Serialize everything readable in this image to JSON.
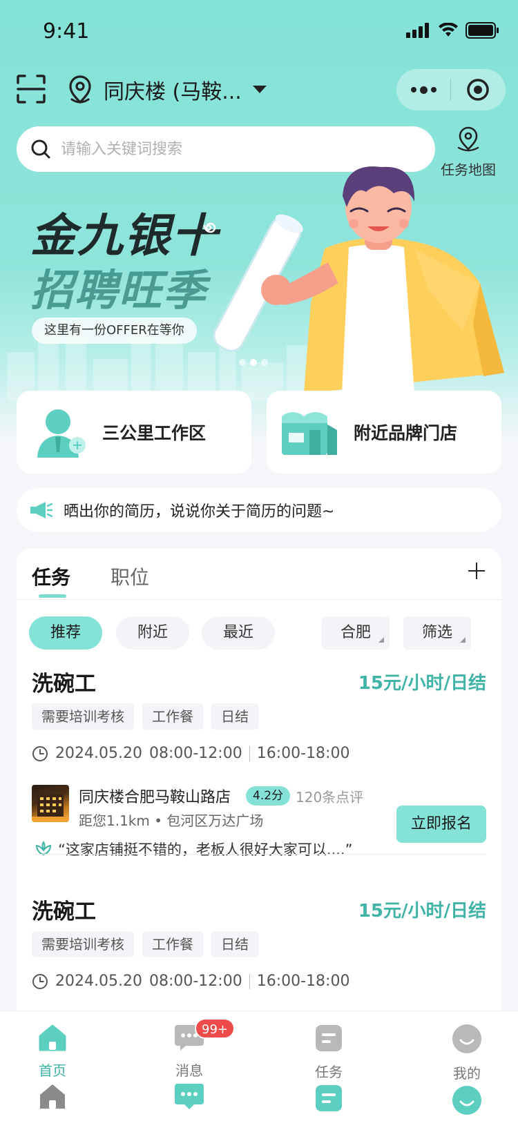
{
  "status_bar": {
    "time": "9:41"
  },
  "header": {
    "location": "同庆楼 (马鞍...",
    "search_placeholder": "请输入关键词搜索",
    "task_map_label": "任务地图"
  },
  "banner": {
    "title_line1": "金九银十",
    "title_line2": "招聘旺季",
    "subtitle": "这里有一份OFFER在等你",
    "active_slide": 2,
    "slide_count": 3
  },
  "quick_entries": [
    {
      "label": "三公里工作区",
      "icon": "worker-avatar-icon"
    },
    {
      "label": "附近品牌门店",
      "icon": "storefront-icon"
    }
  ],
  "notice": {
    "text": "晒出你的简历，说说你关于简历的问题~",
    "icon": "megaphone-icon"
  },
  "list": {
    "tabs": [
      "任务",
      "职位"
    ],
    "active_tab": "任务",
    "filters": [
      "推荐",
      "附近",
      "最近"
    ],
    "active_filter": "推荐",
    "city_select": "合肥",
    "filter_select": "筛选",
    "jobs": [
      {
        "title": "洗碗工",
        "pay": "15元/小时/日结",
        "tags": [
          "需要培训考核",
          "工作餐",
          "日结"
        ],
        "date": "2024.05.20",
        "slot1": "08:00-12:00",
        "slot2": "16:00-18:00",
        "store": {
          "name": "同庆楼合肥马鞍山路店",
          "score": "4.2分",
          "reviews": "120条点评",
          "distance": "距您1.1km • 包河区万达广场",
          "quote": "“这家店铺挺不错的，老板人很好大家可以....”"
        },
        "apply_label": "立即报名"
      },
      {
        "title": "洗碗工",
        "pay": "15元/小时/日结",
        "tags": [
          "需要培训考核",
          "工作餐",
          "日结"
        ],
        "date": "2024.05.20",
        "slot1": "08:00-12:00",
        "slot2": "16:00-18:00"
      }
    ]
  },
  "tabbar": {
    "items": [
      {
        "label": "首页",
        "icon": "home-icon"
      },
      {
        "label": "消息",
        "icon": "message-icon",
        "badge": "99+"
      },
      {
        "label": "任务",
        "icon": "task-icon"
      },
      {
        "label": "我的",
        "icon": "profile-icon"
      }
    ],
    "active": "首页"
  },
  "colors": {
    "accent": "#84e2d7",
    "accent_text": "#3fb3a6",
    "badge": "#f04b4b"
  }
}
